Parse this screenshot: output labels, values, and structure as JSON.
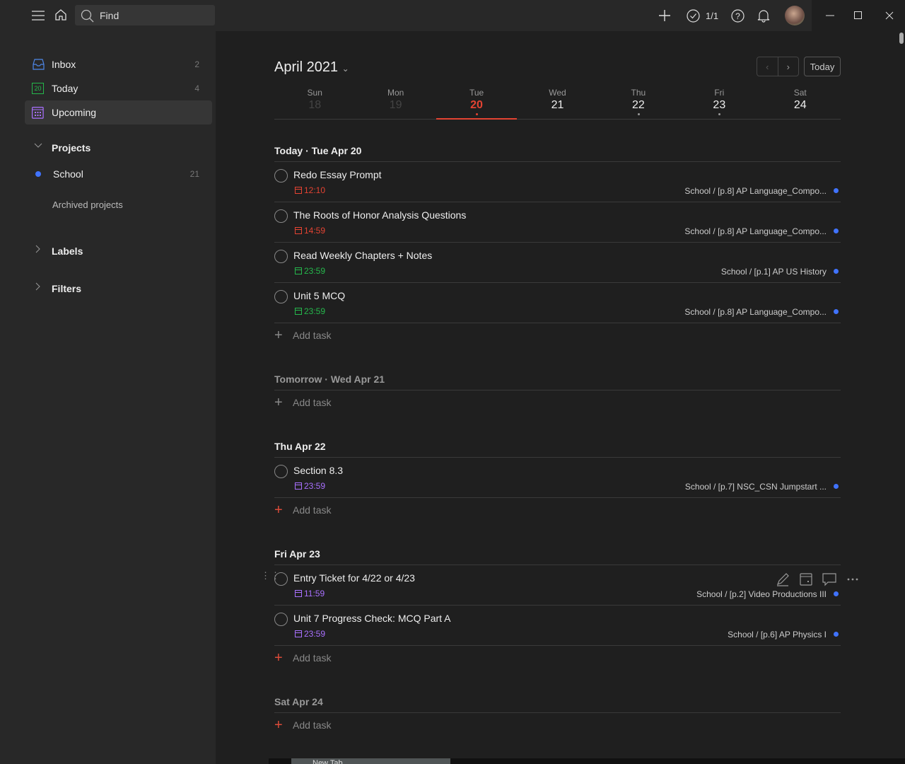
{
  "topbar": {
    "search_placeholder": "Find",
    "karma": "1/1"
  },
  "sidebar": {
    "items": [
      {
        "label": "Inbox",
        "count": "2"
      },
      {
        "label": "Today",
        "count": "4",
        "icon_day": "20"
      },
      {
        "label": "Upcoming",
        "count": ""
      }
    ],
    "projects_label": "Projects",
    "projects": [
      {
        "label": "School",
        "count": "21",
        "color": "#4073ff"
      }
    ],
    "archived_label": "Archived projects",
    "labels_label": "Labels",
    "filters_label": "Filters"
  },
  "header": {
    "month": "April 2021",
    "today_button": "Today"
  },
  "week": [
    {
      "name": "Sun",
      "date": "18"
    },
    {
      "name": "Mon",
      "date": "19"
    },
    {
      "name": "Tue",
      "date": "20"
    },
    {
      "name": "Wed",
      "date": "21"
    },
    {
      "name": "Thu",
      "date": "22"
    },
    {
      "name": "Fri",
      "date": "23"
    },
    {
      "name": "Sat",
      "date": "24"
    }
  ],
  "sections": [
    {
      "title": "Today · Tue Apr 20",
      "tasks": [
        {
          "title": "Redo Essay Prompt",
          "due": "12:10",
          "project": "School / [p.8] AP Language_Compo..."
        },
        {
          "title": "The Roots of Honor Analysis Questions",
          "due": "14:59",
          "project": "School / [p.8] AP Language_Compo..."
        },
        {
          "title": "Read Weekly Chapters + Notes",
          "due": "23:59",
          "project": "School / [p.1] AP US History"
        },
        {
          "title": "Unit 5 MCQ",
          "due": "23:59",
          "project": "School / [p.8] AP Language_Compo..."
        }
      ]
    },
    {
      "title": "Tomorrow · Wed Apr 21",
      "tasks": []
    },
    {
      "title": "Thu Apr 22",
      "tasks": [
        {
          "title": "Section 8.3",
          "due": "23:59",
          "project": "School / [p.7] NSC_CSN Jumpstart ..."
        }
      ]
    },
    {
      "title": "Fri Apr 23",
      "tasks": [
        {
          "title": "Entry Ticket for 4/22 or 4/23",
          "due": "11:59",
          "project": "School / [p.2] Video Productions III"
        },
        {
          "title": "Unit 7 Progress Check: MCQ Part A",
          "due": "23:59",
          "project": "School / [p.6] AP Physics I"
        }
      ]
    },
    {
      "title": "Sat Apr 24",
      "tasks": []
    }
  ],
  "add_task_label": "Add task",
  "bottom_tab": "New Tab",
  "colors": {
    "red": "#e44332",
    "green": "#25b84c",
    "purple": "#a970ff",
    "blue": "#4073ff"
  }
}
